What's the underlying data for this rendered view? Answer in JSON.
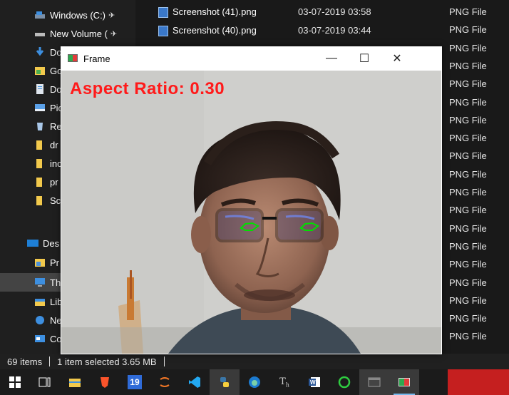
{
  "sidebar": {
    "items": [
      {
        "label": "Windows (C:)",
        "pin": "✈",
        "icon": "drive-icon"
      },
      {
        "label": "New Volume (",
        "pin": "✈",
        "icon": "drive-icon"
      },
      {
        "label": "Do",
        "icon": "downloads-icon"
      },
      {
        "label": "Go",
        "icon": "folder-icon"
      },
      {
        "label": "Do",
        "icon": "documents-icon"
      },
      {
        "label": "Pic",
        "icon": "pictures-icon"
      },
      {
        "label": "Re",
        "icon": "recycle-icon"
      },
      {
        "label": "dr",
        "icon": "folder-icon"
      },
      {
        "label": "inc",
        "icon": "folder-icon"
      },
      {
        "label": "pr",
        "icon": "folder-icon"
      },
      {
        "label": "Sc",
        "icon": "folder-icon"
      },
      {
        "label": "Des",
        "icon": "desktop-icon"
      },
      {
        "label": "Pr",
        "icon": "folder-icon"
      },
      {
        "label": "Th",
        "icon": "this-pc-icon"
      },
      {
        "label": "Lib",
        "icon": "libraries-icon"
      },
      {
        "label": "Ne",
        "icon": "network-icon"
      },
      {
        "label": "Co",
        "icon": "control-panel-icon"
      }
    ]
  },
  "files": [
    {
      "name": "Screenshot (41).png",
      "date": "03-07-2019 03:58"
    },
    {
      "name": "Screenshot (40).png",
      "date": "03-07-2019 03:44"
    }
  ],
  "file_type": "PNG File",
  "type_rows": 19,
  "status": {
    "count": "69 items",
    "selection": "1 item selected  3.65 MB"
  },
  "frame": {
    "title": "Frame",
    "minimize": "—",
    "maximize": "☐",
    "close": "✕",
    "overlay_text": "Aspect Ratio: 0.30"
  },
  "taskbar": {
    "icons": [
      "windows-start-icon",
      "task-view-icon",
      "file-explorer-icon",
      "brave-icon",
      "calendar-app-icon",
      "jupyter-icon",
      "vscode-icon",
      "python-icon",
      "edge-icon",
      "typora-icon",
      "word-icon",
      "green-circle-app-icon",
      "terminal-icon",
      "python-frame-icon"
    ],
    "calendar_day": "19"
  },
  "colors": {
    "overlay_red": "#ff1a1a",
    "eye_contour_green": "#00e000",
    "taskbar_active_underline": "#76b9ed"
  }
}
